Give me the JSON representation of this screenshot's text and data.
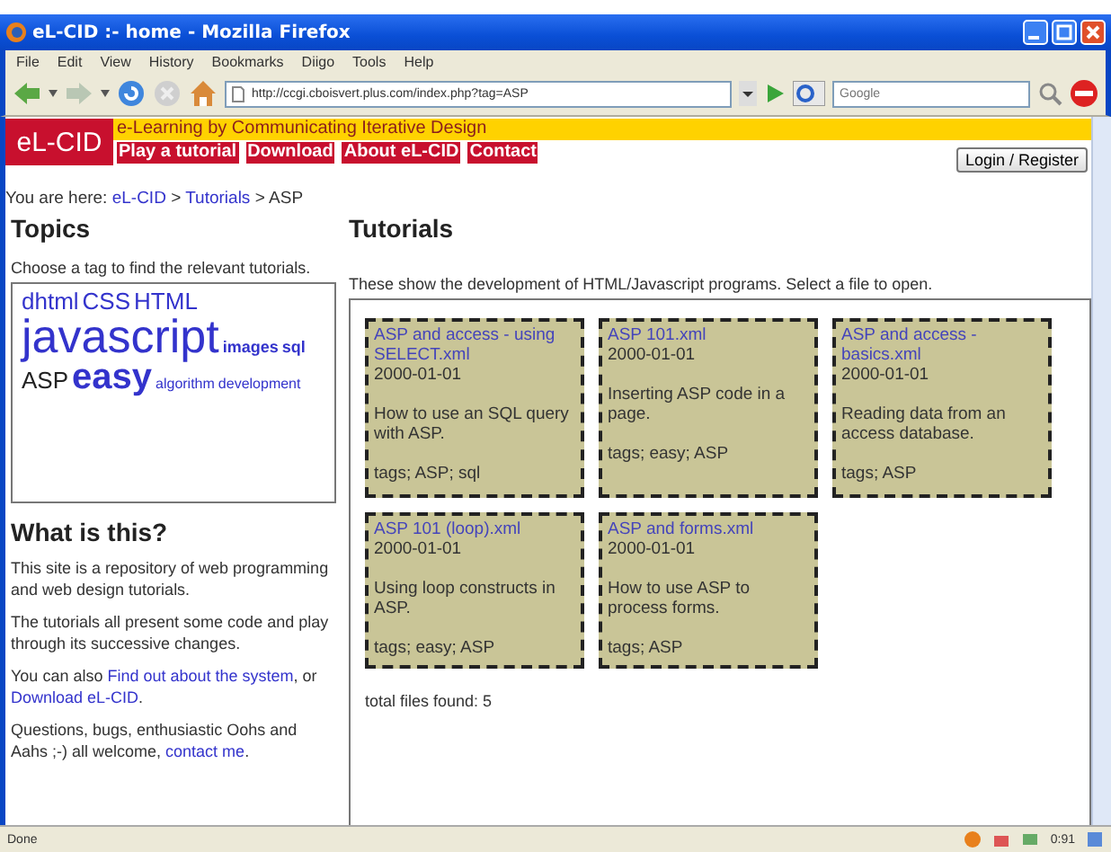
{
  "window": {
    "title": "eL-CID :- home - Mozilla Firefox"
  },
  "menu": [
    "File",
    "Edit",
    "View",
    "History",
    "Bookmarks",
    "Diigo",
    "Tools",
    "Help"
  ],
  "toolbar": {
    "url": "http://ccgi.cboisvert.plus.com/index.php?tag=ASP",
    "search_placeholder": "Google"
  },
  "site": {
    "logo": "eL-CID",
    "tagline": "e-Learning by Communicating Iterative Design",
    "nav": [
      "Play a tutorial",
      "Download",
      "About eL-CID",
      "Contact"
    ],
    "login": "Login / Register"
  },
  "breadcrumb": {
    "prefix": "You are here:",
    "items": [
      {
        "label": "eL-CID",
        "kind": "link"
      },
      {
        "label": ">",
        "kind": "sep"
      },
      {
        "label": "Tutorials",
        "kind": "link"
      },
      {
        "label": ">",
        "kind": "sep"
      },
      {
        "label": "ASP",
        "kind": "text"
      }
    ]
  },
  "sidebar": {
    "title": "Topics",
    "hint": "Choose a tag to find the relevant tutorials.",
    "tags": [
      {
        "label": "dhtml",
        "kind": "medium",
        "selected": false
      },
      {
        "label": "CSS",
        "kind": "medium",
        "selected": false
      },
      {
        "label": "HTML",
        "kind": "medium",
        "selected": false
      },
      {
        "label": "javascript",
        "kind": "huge",
        "selected": false
      },
      {
        "label": "images",
        "kind": "small",
        "selected": false
      },
      {
        "label": "sql",
        "kind": "small",
        "selected": false
      },
      {
        "label": "ASP",
        "kind": "medium",
        "selected": true
      },
      {
        "label": "easy",
        "kind": "large",
        "selected": false
      },
      {
        "label": "algorithm",
        "kind": "tiny",
        "selected": false
      },
      {
        "label": "development",
        "kind": "tiny",
        "selected": false
      }
    ],
    "about_title": "What is this?",
    "paragraphs": [
      {
        "parts": [
          {
            "text": "This site is a repository of web programming and web design tutorials.",
            "kind": "text"
          }
        ]
      },
      {
        "parts": [
          {
            "text": "The tutorials all present some code and play through its successive changes.",
            "kind": "text"
          }
        ]
      },
      {
        "parts": [
          {
            "text": "You can also ",
            "kind": "text"
          },
          {
            "text": "Find out about the system",
            "kind": "link"
          },
          {
            "text": ", or ",
            "kind": "text"
          },
          {
            "text": "Download eL-CID",
            "kind": "link"
          },
          {
            "text": ".",
            "kind": "text"
          }
        ]
      },
      {
        "parts": [
          {
            "text": "Questions, bugs, enthusiastic Oohs and Aahs ;-) all welcome, ",
            "kind": "text"
          },
          {
            "text": "contact me",
            "kind": "link"
          },
          {
            "text": ".",
            "kind": "text"
          }
        ]
      }
    ]
  },
  "main": {
    "title": "Tutorials",
    "intro": "These show the development of HTML/Javascript programs. Select a file to open.",
    "files": [
      {
        "name": "ASP and access - using SELECT.xml",
        "date": "2000-01-01",
        "description": "How to use an SQL query with ASP.",
        "tags": "tags; ASP; sql"
      },
      {
        "name": "ASP 101.xml",
        "date": "2000-01-01",
        "description": "Inserting ASP code in a page.",
        "tags": "tags; easy; ASP"
      },
      {
        "name": "ASP and access - basics.xml",
        "date": "2000-01-01",
        "description": "Reading data from an access database.",
        "tags": "tags; ASP"
      },
      {
        "name": "ASP 101 (loop).xml",
        "date": "2000-01-01",
        "description": "Using loop constructs in ASP.",
        "tags": "tags; easy; ASP"
      },
      {
        "name": "ASP and forms.xml",
        "date": "2000-01-01",
        "description": "How to use ASP to process forms.",
        "tags": "tags; ASP"
      }
    ],
    "total": "total files found: 5"
  },
  "status_bar": {
    "text": "Done",
    "clock": "0:91"
  }
}
